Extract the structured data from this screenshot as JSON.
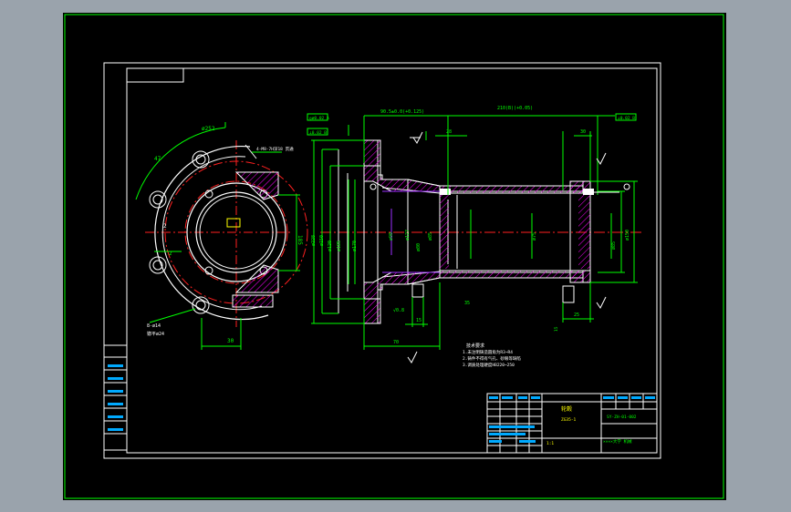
{
  "colors": {
    "background": "#9aa3ac",
    "paper": "#000000",
    "outline": "#ffffff",
    "dimension": "#00ff00",
    "center_line": "#ff2020",
    "hatch": "#ff00ff",
    "text": "#ffff00"
  },
  "drawing": {
    "dims_left": {
      "d1": "ø252",
      "d2": "8-ø14",
      "d3": "锪平ø24",
      "d4": "30",
      "d5": "185",
      "d6": "47",
      "d7": "2",
      "d8": "4-M8-7H深18 贯通"
    },
    "dims_right": {
      "top1": "90.5±0.0(+0.125)",
      "top2": "210(B)(+0.05)",
      "top3": "√0.8",
      "datum_a": "◎ø0.02 A",
      "datum_b": "⊥0.02 B",
      "h1": "28",
      "h2": "35",
      "h3": "30",
      "h4": "15",
      "h5": "70",
      "h6": "15",
      "h7": "25",
      "v1": "ø228",
      "v2": "ø150",
      "v3": "ø120",
      "v4": "ø185",
      "v5": "ø170",
      "v6": "ø150",
      "v7": "ø90",
      "v8": "ø127",
      "v9": "ø80",
      "v10": "ø85",
      "v11": "ø75",
      "v12": "ø85"
    },
    "notes": {
      "title": "技术要求",
      "line1": "1.未注明铸造圆角为R3~R4",
      "line2": "2.铸件不得有气孔、砂眼等缺陷",
      "line3": "3.调质处理硬度HB220~250"
    },
    "title_block": {
      "part_name": "轮毂",
      "material": "ZG35-1",
      "scale": "1:1",
      "drawing_no": "SY-ZH-01-002",
      "company": "××××大学 机械"
    }
  }
}
